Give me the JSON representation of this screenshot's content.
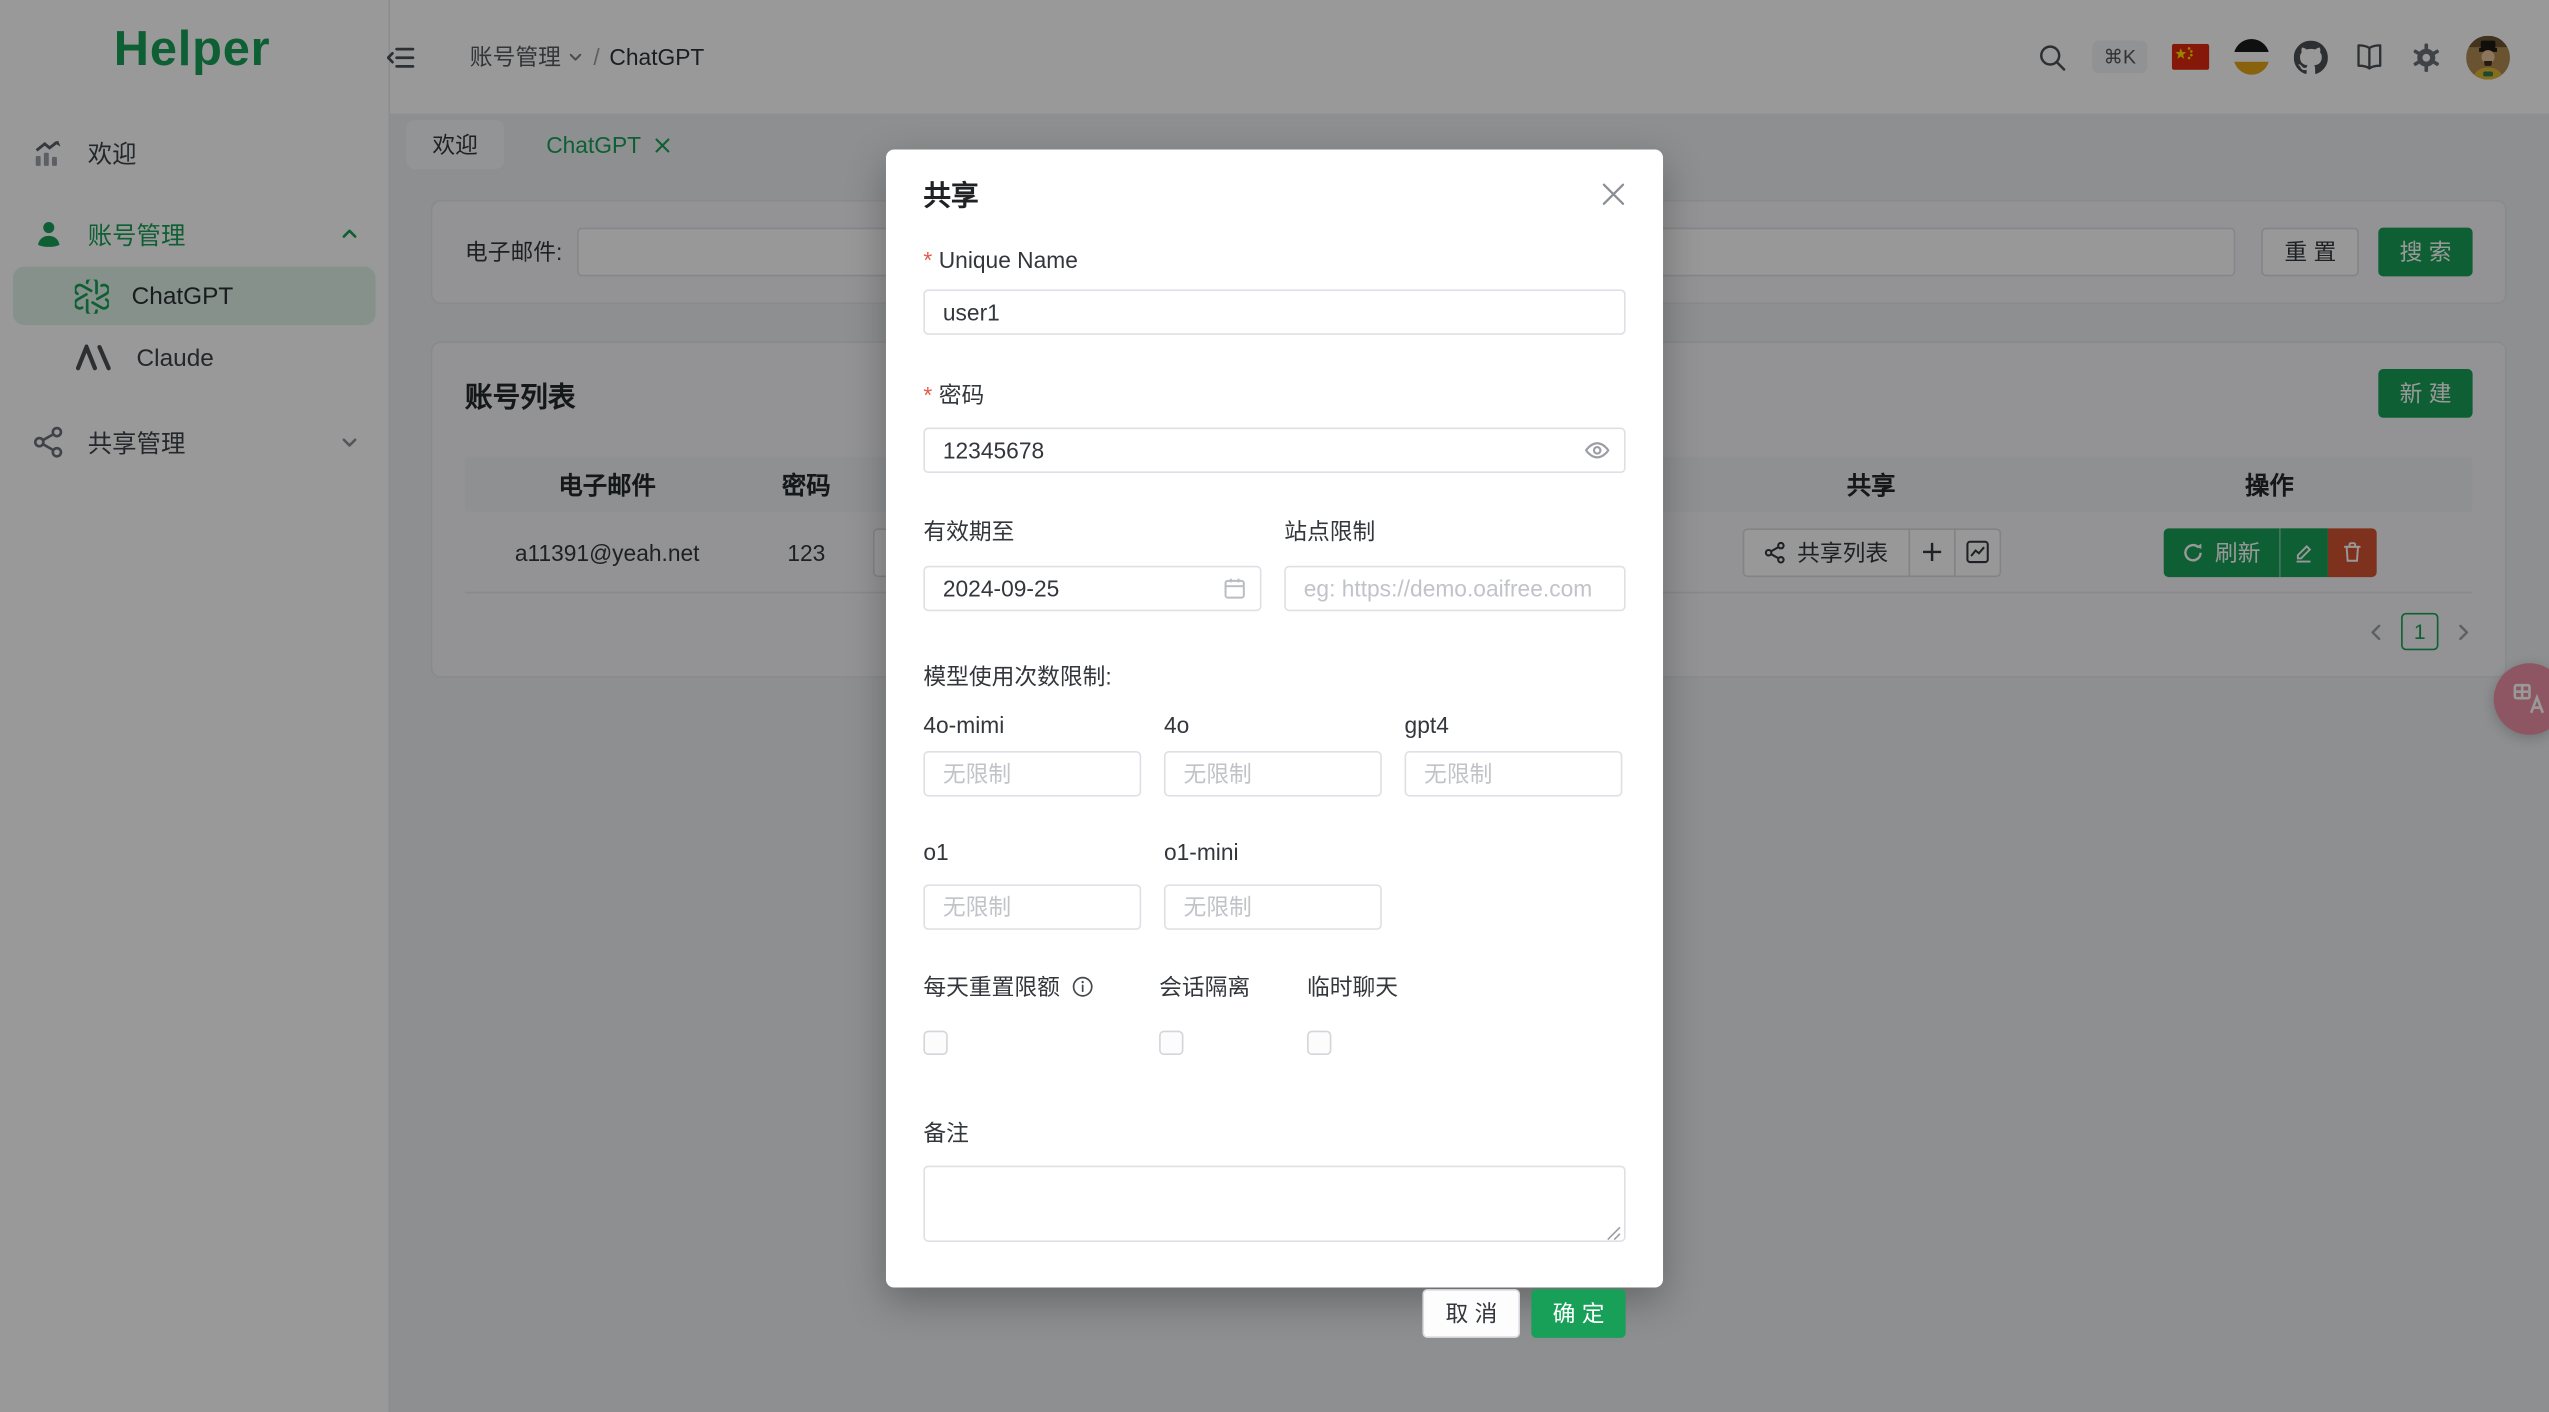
{
  "app": {
    "logo": "Helper"
  },
  "sidebar": {
    "items": [
      {
        "label": "欢迎"
      },
      {
        "label": "账号管理"
      },
      {
        "label": "ChatGPT"
      },
      {
        "label": "Claude"
      },
      {
        "label": "共享管理"
      }
    ]
  },
  "header": {
    "breadcrumb": {
      "section": "账号管理",
      "separator": "/",
      "page": "ChatGPT"
    },
    "shortcut": "⌘K"
  },
  "tabs": {
    "welcome": "欢迎",
    "chatgpt": "ChatGPT"
  },
  "filter": {
    "email_label": "电子邮件:",
    "reset_button": "重 置",
    "search_button": "搜 索"
  },
  "accounts": {
    "title": "账号列表",
    "new_button": "新 建",
    "headers": {
      "email": "电子邮件",
      "password": "密码",
      "share": "共享",
      "actions": "操作"
    },
    "row": {
      "email": "a11391@yeah.net",
      "password": "123"
    },
    "share_list_button": "共享列表",
    "refresh_button": "刷新",
    "pagination": {
      "page": "1"
    }
  },
  "modal": {
    "title": "共享",
    "required_mark": "*",
    "unique_name": {
      "label": "Unique Name",
      "value": "user1"
    },
    "password": {
      "label": "密码",
      "value": "12345678"
    },
    "valid_until": {
      "label": "有效期至",
      "value": "2024-09-25"
    },
    "site_limit": {
      "label": "站点限制",
      "placeholder": "eg: https://demo.oaifree.com"
    },
    "model_limits_title": "模型使用次数限制:",
    "model_placeholder": "无限制",
    "models": [
      {
        "name": "4o-mimi"
      },
      {
        "name": "4o"
      },
      {
        "name": "gpt4"
      },
      {
        "name": "o1"
      },
      {
        "name": "o1-mini"
      }
    ],
    "checkboxes": [
      {
        "label": "每天重置限额"
      },
      {
        "label": "会话隔离"
      },
      {
        "label": "临时聊天"
      }
    ],
    "remark_label": "备注",
    "cancel_button": "取 消",
    "confirm_button": "确 定"
  },
  "colors": {
    "primary": "#18a058",
    "danger": "#d35230",
    "required": "#e25a49",
    "float_pink": "#ec8fa3"
  }
}
